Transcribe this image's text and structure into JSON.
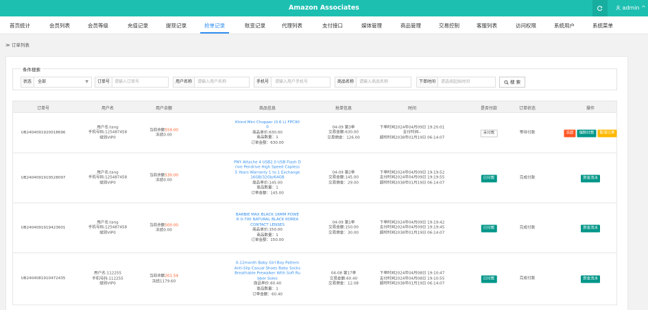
{
  "app": {
    "title": "Amazon Associates",
    "refresh_icon": "refresh-icon",
    "user_label": "admin ^"
  },
  "nav": {
    "items": [
      "首页统计",
      "会员列表",
      "会员等级",
      "充值记录",
      "提现记录",
      "抢单记录",
      "账变记录",
      "代理列表",
      "支付接口",
      "媒体管理",
      "商品管理",
      "交易控制",
      "客服列表",
      "访问权限",
      "系统用户",
      "系统菜单"
    ],
    "active": "抢单记录"
  },
  "breadcrumb": "订单列表",
  "search": {
    "legend": "条件搜索",
    "status_label": "状态",
    "status_value": "全部",
    "order_label": "订单号",
    "order_placeholder": "请输入订单号",
    "username_label": "用户名称",
    "username_placeholder": "请输入用户名称",
    "phone_label": "手机号",
    "phone_placeholder": "请输入用户手机号",
    "product_label": "商品名称",
    "product_placeholder": "请输入商品名称",
    "time_label": "下单时间",
    "time_placeholder": "请选择起始时间",
    "button_label": "搜 索"
  },
  "table": {
    "headers": [
      "订单号",
      "用户名",
      "用户余额",
      "商品信息",
      "抢单信息",
      "时间",
      "是否付款",
      "订单状态",
      "操作"
    ],
    "rows": [
      {
        "order_no": "UB2404091920018696",
        "user": [
          "用户名:tang",
          "手机号码:125487458",
          "级别VIP0"
        ],
        "balance_prefix": "当前余额",
        "balance_value": "559.00",
        "frozen": "冻结0.00",
        "product_title": [
          "Khind Mini Chopper (0.6 L) FPC90",
          "0"
        ],
        "product_lines": [
          "商品单价:630.00",
          "商品数量：1",
          "订单金额：630.00"
        ],
        "grab": [
          "04-09 第3单",
          "交易金额:630.00",
          "交易佣金：126.00"
        ],
        "time": [
          "下单时间2024年04月09日 19:20:01",
          "支付时间--",
          "超时时间2038年01月19日 06:14:07"
        ],
        "pay": "未付款",
        "status": "等待付款",
        "actions": [
          "冻结",
          "强制付款",
          "取消订单"
        ]
      },
      {
        "order_no": "UB2404091919528097",
        "user": [
          "用户名:tang",
          "手机号码:125487458",
          "级别VIP0"
        ],
        "balance_prefix": "当前余额",
        "balance_value": "530.00",
        "frozen": "冻结0.00",
        "product_title": [
          "PNY Attache 4 USB2.0 USB Flash D",
          "rive Pendrive High Speed Capless",
          "5 Years Warranty 1 to 1 Exchange",
          "16GB/32Gb/64GB"
        ],
        "product_lines": [
          "商品单价:145.00",
          "商品数量：1",
          "订单金额：145.00"
        ],
        "grab": [
          "04-09 第2单",
          "交易金额:145.00",
          "交易佣金：29.00"
        ],
        "time": [
          "下单时间2024年04月09日 19:19:52",
          "支付时间2024年04月09日 19:19:55",
          "超时时间2038年01月19日 06:14:07"
        ],
        "pay": "已付款",
        "status": "完成付款",
        "actions": [
          "资金流水"
        ]
      },
      {
        "order_no": "UB2404091919423601",
        "user": [
          "用户名:tang",
          "手机号码:125487458",
          "级别VIP0"
        ],
        "balance_prefix": "当前余额",
        "balance_value": "500.00",
        "frozen": "冻结0.00",
        "product_title": [
          "BARBIE MAX BLACK 16MM POWE",
          "R 0-700 NATURAL BLACK KOREA",
          "CONTACT LENSES"
        ],
        "product_lines": [
          "商品单价:150.00",
          "商品数量：1",
          "订单金额：150.00"
        ],
        "grab": [
          "04-09 第1单",
          "交易金额:150.00",
          "交易佣金：30.00"
        ],
        "time": [
          "下单时间2024年04月09日 19:19:42",
          "支付时间2024年04月09日 19:19:45",
          "超时时间2038年01月19日 06:14:07"
        ],
        "pay": "已付款",
        "status": "完成付款",
        "actions": [
          "资金流水"
        ]
      },
      {
        "order_no": "UB2404081910472435",
        "user": [
          "用户名:112255",
          "手机号码:112255",
          "级别VIP0"
        ],
        "balance_prefix": "当前余额",
        "balance_value": "201.54",
        "frozen": "冻结1179.60",
        "product_title": [
          "0-12month Baby Girl Boy Pattern",
          "Anti-Slip Casual Shoes Baby Socks",
          "Breathable Prewalker With Soft Ru",
          "bber Soles"
        ],
        "product_lines": [
          "商品单价:60.40",
          "商品数量：1",
          "订单金额：60.40"
        ],
        "grab": [
          "04-08 第17单",
          "交易金额:60.40",
          "交易佣金：12.08"
        ],
        "time": [
          "下单时间2024年04月08日 19:10:47",
          "支付时间2024年04月08日 19:10:55",
          "超时时间2038年01月19日 06:14:07"
        ],
        "pay": "已付款",
        "status": "完成付款",
        "actions": [
          "资金流水"
        ]
      }
    ]
  },
  "colors": {
    "brand": "#1dbfb1",
    "active": "#2d8cf0",
    "red": "#ff5722",
    "green": "#009688",
    "yellow": "#ffb800"
  }
}
